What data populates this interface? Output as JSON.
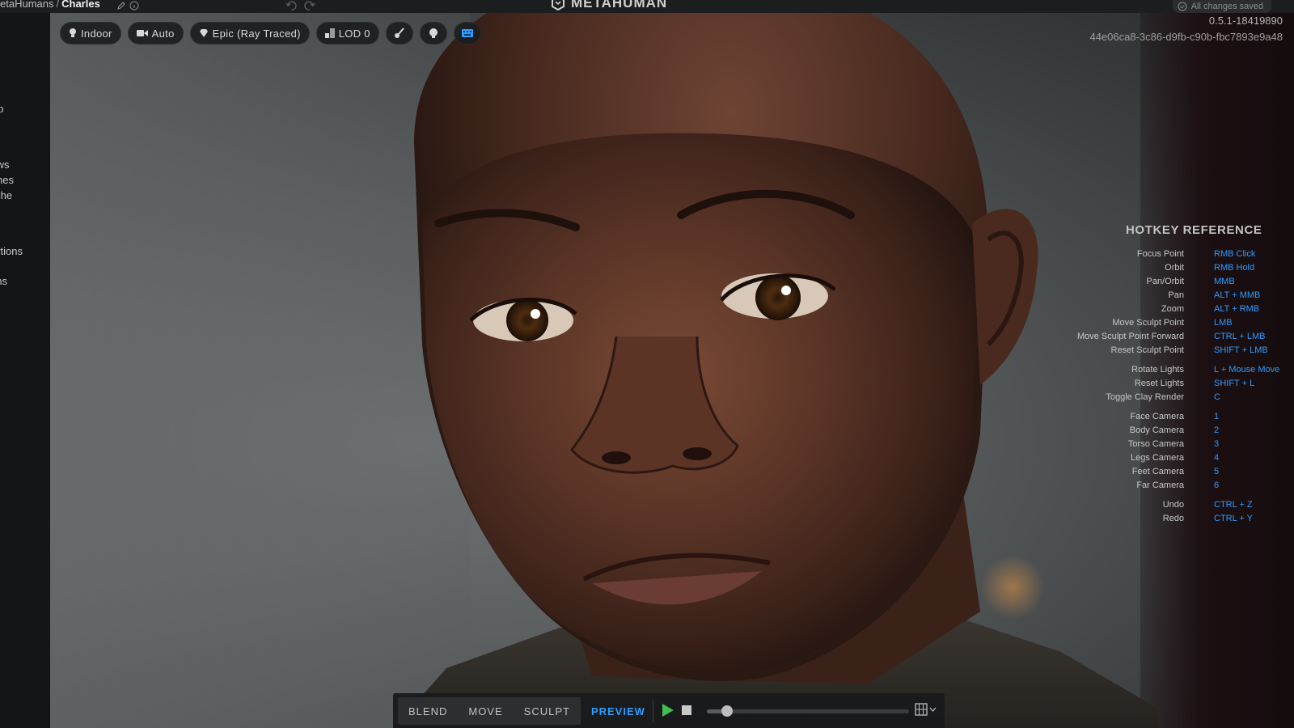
{
  "topbar": {
    "breadcrumb_parent": "etaHumans",
    "breadcrumb_separator": "/",
    "breadcrumb_current": "Charles",
    "logo_text": "METAHUMAN",
    "saved_status": "All changes saved"
  },
  "sidebar": {
    "items": [
      {
        "label": "up"
      },
      {
        "label": "ows"
      },
      {
        "label": "shes"
      },
      {
        "label": "che"
      },
      {
        "label": "rtions"
      },
      {
        "label": "ms"
      }
    ]
  },
  "viewport_toolbar": {
    "lighting": {
      "label": "Indoor",
      "icon": "lightbulb-icon"
    },
    "camera": {
      "label": "Auto",
      "icon": "video-camera-icon"
    },
    "quality": {
      "label": "Epic (Ray Traced)",
      "icon": "diamond-icon"
    },
    "lod": {
      "label": "LOD 0",
      "icon": "lod-icon"
    },
    "icons": [
      "brush-icon",
      "head-icon",
      "keyboard-icon"
    ]
  },
  "version": "0.5.1-18419890",
  "asset_id": "44e06ca8-3c86-d9fb-c90b-fbc7893e9a48",
  "hotkeys": {
    "title": "HOTKEY REFERENCE",
    "rows": [
      {
        "action": "Focus Point",
        "key": "RMB Click"
      },
      {
        "action": "Orbit",
        "key": "RMB Hold"
      },
      {
        "action": "Pan/Orbit",
        "key": "MMB"
      },
      {
        "action": "Pan",
        "key": "ALT + MMB"
      },
      {
        "action": "Zoom",
        "key": "ALT + RMB"
      },
      {
        "action": "Move Sculpt Point",
        "key": "LMB"
      },
      {
        "action": "Move Sculpt Point Forward",
        "key": "CTRL + LMB"
      },
      {
        "action": "Reset Sculpt Point",
        "key": "SHIFT + LMB"
      },
      {
        "action": "Rotate Lights",
        "key": "L + Mouse Move"
      },
      {
        "action": "Reset Lights",
        "key": "SHIFT + L"
      },
      {
        "action": "Toggle Clay Render",
        "key": "C"
      },
      {
        "action": "Face Camera",
        "key": "1"
      },
      {
        "action": "Body Camera",
        "key": "2"
      },
      {
        "action": "Torso Camera",
        "key": "3"
      },
      {
        "action": "Legs Camera",
        "key": "4"
      },
      {
        "action": "Feet Camera",
        "key": "5"
      },
      {
        "action": "Far Camera",
        "key": "6"
      },
      {
        "action": "Undo",
        "key": "CTRL + Z"
      },
      {
        "action": "Redo",
        "key": "CTRL + Y"
      }
    ]
  },
  "bottombar": {
    "tabs": [
      {
        "label": "BLEND",
        "active": false
      },
      {
        "label": "MOVE",
        "active": false
      },
      {
        "label": "SCULPT",
        "active": false
      },
      {
        "label": "PREVIEW",
        "active": true
      }
    ],
    "timeline_progress": 0.1,
    "icons": [
      "play-icon",
      "stop-icon",
      "render-settings-icon"
    ]
  },
  "colors": {
    "accent": "#2f9bff",
    "play": "#3fbf4f",
    "hotkey_key": "#2f9bff"
  }
}
